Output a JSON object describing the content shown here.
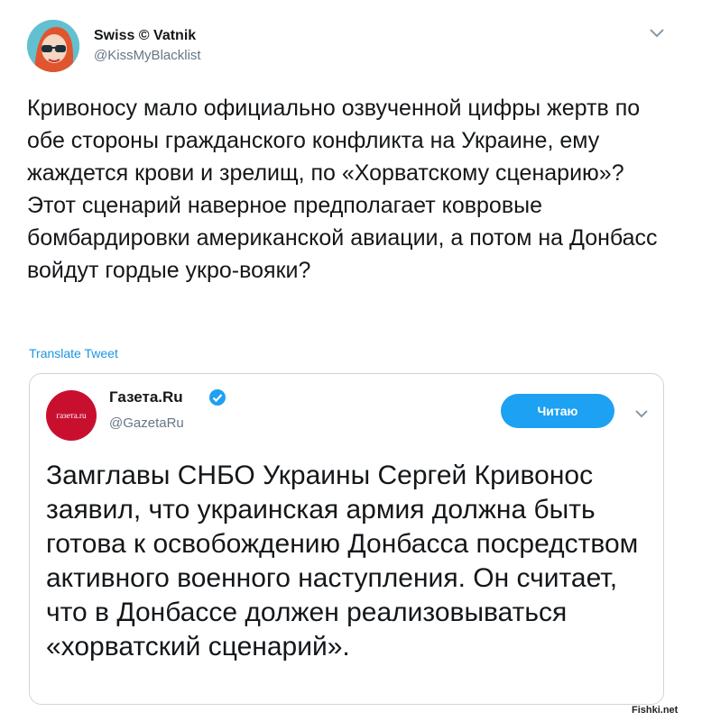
{
  "tweet": {
    "author_name": "Swiss © Vatnik",
    "author_handle": "@KissMyBlacklist",
    "text": "Кривоносу мало официально озвученной цифры жертв по обе стороны гражданского конфликта на Украине, ему жаждется крови и зрелищ, по «Хорватскому сценарию»? Этот сценарий наверное предполагает ковровые бомбардировки американской авиации, а потом на Донбасс войдут гордые укро-вояки?",
    "translate_label": "Translate Tweet"
  },
  "quoted": {
    "author_name": "Газета.Ru",
    "author_handle": "@GazetaRu",
    "avatar_text": "газета.ru",
    "follow_label": "Читаю",
    "text": "Замглавы СНБО Украины Сергей Кривонос заявил, что украинская армия должна быть готова к освобождению Донбасса посредством активного военного наступления. Он считает, что в Донбассе должен реализовываться «хорватский сценарий»."
  },
  "watermark": "Fishki.net",
  "colors": {
    "link": "#1b95e0",
    "button": "#1da1f2",
    "muted": "#657786",
    "gazeta_red": "#c8102e"
  }
}
